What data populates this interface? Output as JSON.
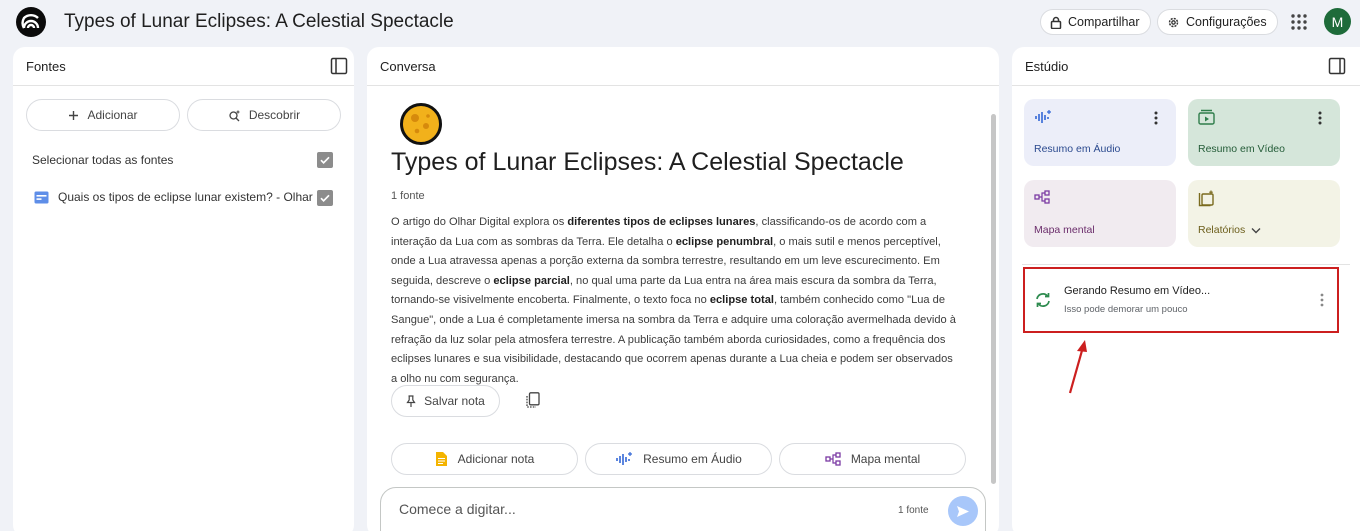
{
  "header": {
    "title": "Types of Lunar Eclipses: A Celestial Spectacle",
    "share_label": "Compartilhar",
    "settings_label": "Configurações",
    "avatar_letter": "M"
  },
  "sources": {
    "heading": "Fontes",
    "add_label": "Adicionar",
    "discover_label": "Descobrir",
    "select_all_label": "Selecionar todas as fontes",
    "select_all_checked": true,
    "items": [
      {
        "title": "Quais os tipos de eclipse lunar existem? - Olhar ...",
        "checked": true
      }
    ]
  },
  "conversation": {
    "heading": "Conversa",
    "title": "Types of Lunar Eclipses: A Celestial Spectacle",
    "source_count": "1 fonte",
    "summary_parts": [
      {
        "text": "O artigo do Olhar Digital explora os ",
        "bold": false
      },
      {
        "text": "diferentes tipos de eclipses lunares",
        "bold": true
      },
      {
        "text": ", classificando-os de acordo com a interação da Lua com as sombras da Terra. Ele detalha o ",
        "bold": false
      },
      {
        "text": "eclipse penumbral",
        "bold": true
      },
      {
        "text": ", o mais sutil e menos perceptível, onde a Lua atravessa apenas a porção externa da sombra terrestre, resultando em um leve escurecimento. Em seguida, descreve o ",
        "bold": false
      },
      {
        "text": "eclipse parcial",
        "bold": true
      },
      {
        "text": ", no qual uma parte da Lua entra na área mais escura da sombra da Terra, tornando-se visivelmente encoberta. Finalmente, o texto foca no ",
        "bold": false
      },
      {
        "text": "eclipse total",
        "bold": true
      },
      {
        "text": ", também conhecido como \"Lua de Sangue\", onde a Lua é completamente imersa na sombra da Terra e adquire uma coloração avermelhada devido à refração da luz solar pela atmosfera terrestre. A publicação também aborda curiosidades, como a frequência dos eclipses lunares e sua visibilidade, destacando que ocorrem apenas durante a Lua cheia e podem ser observados a olho nu com segurança.",
        "bold": false
      }
    ],
    "save_note_label": "Salvar nota",
    "chips": {
      "add_note": "Adicionar nota",
      "audio_summary": "Resumo em Áudio",
      "mind_map": "Mapa mental"
    },
    "input_placeholder": "Comece a digitar...",
    "input_source_count": "1 fonte"
  },
  "studio": {
    "heading": "Estúdio",
    "cards": {
      "audio": "Resumo em Áudio",
      "video": "Resumo em Vídeo",
      "mindmap": "Mapa mental",
      "reports": "Relatórios"
    },
    "generating": {
      "title": "Gerando Resumo em Vídeo...",
      "subtitle": "Isso pode demorar um pouco"
    }
  },
  "colors": {
    "background": "#f0f2f7",
    "audio_card": "#eceef9",
    "video_card": "#d5e6da",
    "mindmap_card": "#f1ebf0",
    "reports_card": "#f3f3e6",
    "highlight": "#cc1f1f",
    "avatar": "#1e6b3a"
  },
  "icons": [
    "notebooklm-logo-icon",
    "lock-icon",
    "gear-icon",
    "apps-grid-icon",
    "panel-toggle-icon",
    "plus-icon",
    "discover-icon",
    "web-source-icon",
    "checkbox-icon",
    "moon-emoji-icon",
    "pin-icon",
    "copy-icon",
    "note-icon",
    "waveform-icon",
    "mind-map-icon",
    "send-icon",
    "video-icon",
    "reports-icon",
    "chevron-down-icon",
    "kebab-icon",
    "sync-icon",
    "arrow-icon"
  ]
}
